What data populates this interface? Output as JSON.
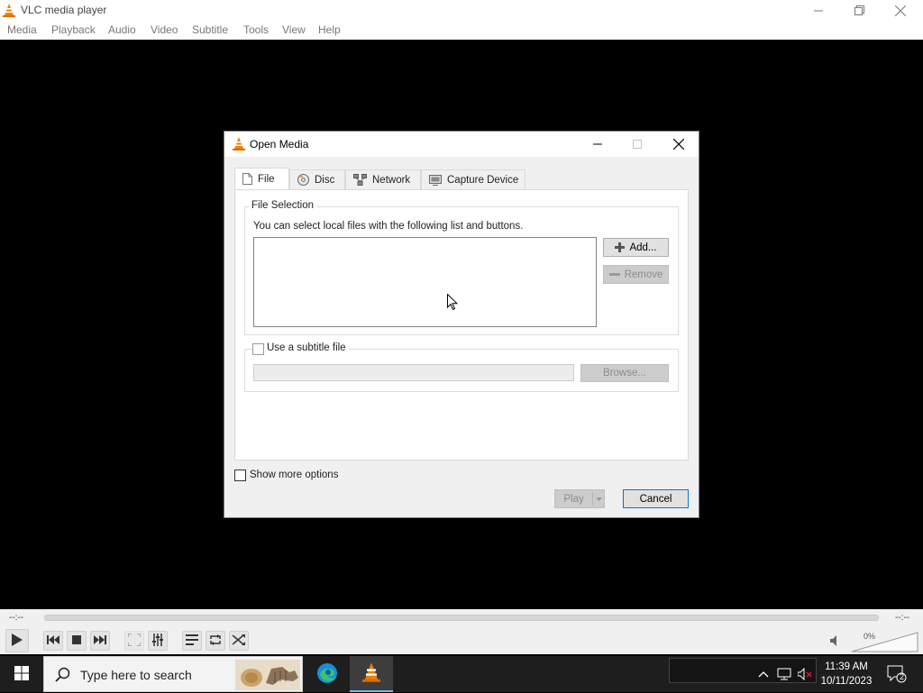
{
  "window": {
    "title": "VLC media player",
    "menu": [
      "Media",
      "Playback",
      "Audio",
      "Video",
      "Subtitle",
      "Tools",
      "View",
      "Help"
    ]
  },
  "dialog": {
    "title": "Open Media",
    "tabs": [
      {
        "label": "File",
        "icon": "file-icon",
        "active": true
      },
      {
        "label": "Disc",
        "icon": "disc-icon",
        "active": false
      },
      {
        "label": "Network",
        "icon": "network-icon",
        "active": false
      },
      {
        "label": "Capture Device",
        "icon": "capture-device-icon",
        "active": false
      }
    ],
    "file_selection": {
      "group_label": "File Selection",
      "description": "You can select local files with the following list and buttons.",
      "add_label": "Add...",
      "remove_label": "Remove"
    },
    "subtitle": {
      "checkbox_label": "Use a subtitle file",
      "checked": false,
      "path_value": "",
      "browse_label": "Browse..."
    },
    "show_more_options": {
      "label": "Show more options",
      "checked": false
    },
    "play_label": "Play",
    "cancel_label": "Cancel"
  },
  "player": {
    "elapsed": "--:--",
    "remaining": "--:--",
    "volume": "0%"
  },
  "taskbar": {
    "search_placeholder": "Type here to search",
    "time": "11:39 AM",
    "date": "10/11/2023",
    "notification_count": "2"
  },
  "colors": {
    "vlc_orange": "#f08000",
    "taskbar_bg": "#1e1e1e",
    "accent_blue": "#0078d7"
  }
}
